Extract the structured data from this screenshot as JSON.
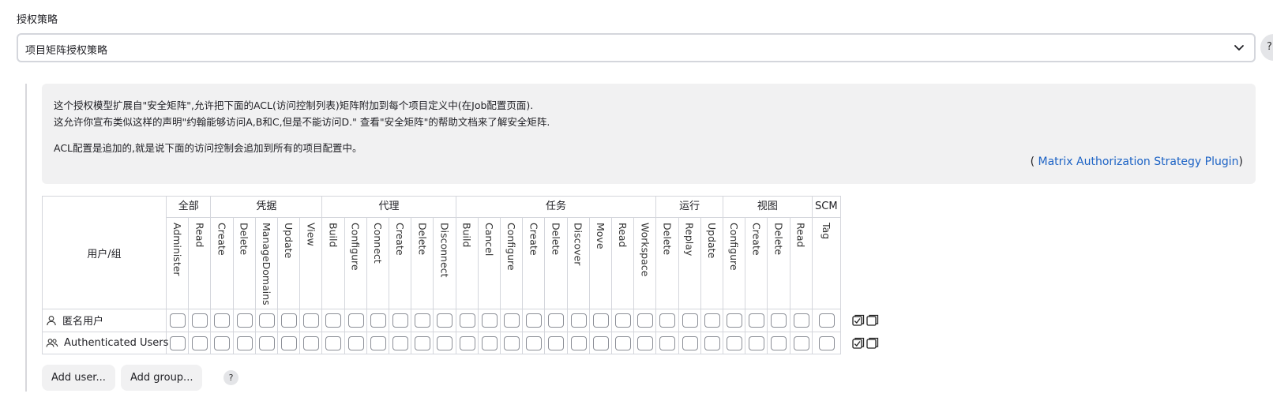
{
  "section_label": "授权策略",
  "strategy_select": {
    "value": "项目矩阵授权策略"
  },
  "top_help": "?",
  "info": {
    "line1": "这个授权模型扩展自\"安全矩阵\",允许把下面的ACL(访问控制列表)矩阵附加到每个项目定义中(在Job配置页面).",
    "line2": "这允许你宣布类似这样的声明\"约翰能够访问A,B和C,但是不能访问D.\" 查看\"安全矩阵\"的帮助文档来了解安全矩阵.",
    "line3": "ACL配置是追加的,就是说下面的访问控制会追加到所有的项目配置中。",
    "link_open": "(",
    "link_text": "Matrix Authorization Strategy Plugin",
    "link_close": ")"
  },
  "matrix": {
    "user_header": "用户/组",
    "groups": [
      {
        "label": "全部",
        "permissions": [
          "Administer",
          "Read"
        ]
      },
      {
        "label": "凭据",
        "permissions": [
          "Create",
          "Delete",
          "ManageDomains",
          "Update",
          "View"
        ]
      },
      {
        "label": "代理",
        "permissions": [
          "Build",
          "Configure",
          "Connect",
          "Create",
          "Delete",
          "Disconnect"
        ]
      },
      {
        "label": "任务",
        "permissions": [
          "Build",
          "Cancel",
          "Configure",
          "Create",
          "Delete",
          "Discover",
          "Move",
          "Read",
          "Workspace"
        ]
      },
      {
        "label": "运行",
        "permissions": [
          "Delete",
          "Replay",
          "Update"
        ]
      },
      {
        "label": "视图",
        "permissions": [
          "Configure",
          "Create",
          "Delete",
          "Read"
        ]
      },
      {
        "label": "SCM",
        "permissions": [
          "Tag"
        ]
      }
    ],
    "rows": [
      {
        "label": "匿名用户",
        "icon": "user-icon",
        "checked": []
      },
      {
        "label": "Authenticated Users",
        "icon": "users-icon",
        "checked": []
      }
    ]
  },
  "buttons": {
    "add_user": "Add user...",
    "add_group": "Add group...",
    "help": "?"
  }
}
